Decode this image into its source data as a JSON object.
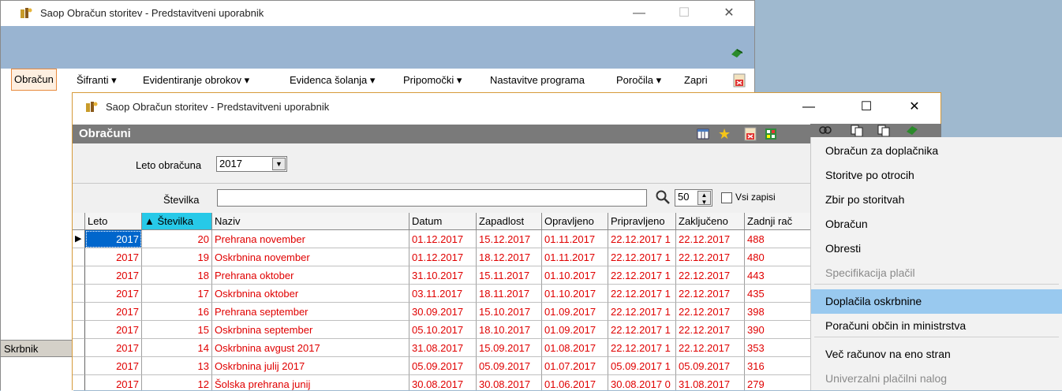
{
  "outer_window": {
    "title": "Saop Obračun storitev - Predstavitveni uporabnik",
    "controls": {
      "minimize": "—",
      "maximize": "☐",
      "close": "✕"
    }
  },
  "menubar": {
    "items": [
      {
        "label": "Obračun"
      },
      {
        "label": "Šifranti ▾"
      },
      {
        "label": "Evidentiranje obrokov ▾"
      },
      {
        "label": "Evidenca šolanja ▾"
      },
      {
        "label": "Pripomočki ▾"
      },
      {
        "label": "Nastavitve programa"
      },
      {
        "label": "Poročila ▾"
      },
      {
        "label": "Zapri"
      }
    ]
  },
  "left_panel": {
    "skrbnik": "Skrbnik"
  },
  "inner_window": {
    "title": "Saop Obračun storitev - Predstavitveni uporabnik",
    "controls": {
      "minimize": "—",
      "maximize": "☐",
      "close": "✕"
    },
    "header": "Obračuni"
  },
  "filters": {
    "leto_label": "Leto obračuna",
    "leto_value": "2017",
    "stevilka_label": "Številka",
    "stevilka_value": "",
    "page_size": "50",
    "vsi_zapisi_label": "Vsi zapisi"
  },
  "grid": {
    "columns": [
      "Leto",
      "▲ Številka",
      "Naziv",
      "Datum",
      "Zapadlost",
      "Opravljeno",
      "Pripravljeno",
      "Zaključeno",
      "Zadnji rač"
    ],
    "rows": [
      [
        "2017",
        "20",
        "Prehrana november",
        "01.12.2017",
        "15.12.2017",
        "01.11.2017",
        "22.12.2017 1",
        "22.12.2017",
        "488"
      ],
      [
        "2017",
        "19",
        "Oskrbnina november",
        "01.12.2017",
        "18.12.2017",
        "01.11.2017",
        "22.12.2017 1",
        "22.12.2017",
        "480"
      ],
      [
        "2017",
        "18",
        "Prehrana oktober",
        "31.10.2017",
        "15.11.2017",
        "01.10.2017",
        "22.12.2017 1",
        "22.12.2017",
        "443"
      ],
      [
        "2017",
        "17",
        "Oskrbnina oktober",
        "03.11.2017",
        "18.11.2017",
        "01.10.2017",
        "22.12.2017 1",
        "22.12.2017",
        "435"
      ],
      [
        "2017",
        "16",
        "Prehrana september",
        "30.09.2017",
        "15.10.2017",
        "01.09.2017",
        "22.12.2017 1",
        "22.12.2017",
        "398"
      ],
      [
        "2017",
        "15",
        "Oskrbnina september",
        "05.10.2017",
        "18.10.2017",
        "01.09.2017",
        "22.12.2017 1",
        "22.12.2017",
        "390"
      ],
      [
        "2017",
        "14",
        "Oskrbnina avgust 2017",
        "31.08.2017",
        "15.09.2017",
        "01.08.2017",
        "22.12.2017 1",
        "22.12.2017",
        "353"
      ],
      [
        "2017",
        "13",
        "Oskrbnina julij 2017",
        "05.09.2017",
        "05.09.2017",
        "01.07.2017",
        "05.09.2017 1",
        "05.09.2017",
        "316"
      ],
      [
        "2017",
        "12",
        "Šolska prehrana junij",
        "30.08.2017",
        "30.08.2017",
        "01.06.2017",
        "30.08.2017 0",
        "31.08.2017",
        "279"
      ]
    ]
  },
  "popup_menu": {
    "items": [
      {
        "label": "Obračun za doplačnika",
        "disabled": false
      },
      {
        "label": "Storitve po otrocih",
        "disabled": false
      },
      {
        "label": "Zbir po storitvah",
        "disabled": false
      },
      {
        "label": "Obračun",
        "disabled": false
      },
      {
        "label": "Obresti",
        "disabled": false
      },
      {
        "label": "Specifikacija plačil",
        "disabled": true
      },
      {
        "label": "Doplačila oskrbnine",
        "disabled": false,
        "highlighted": true
      },
      {
        "label": "Poračuni občin in ministrstva",
        "disabled": false
      },
      {
        "label": "Več računov na eno stran",
        "disabled": false
      },
      {
        "label": "Univerzalni plačilni nalog",
        "disabled": true
      }
    ]
  },
  "colors": {
    "row_text": "#e00000",
    "selection": "#0066cc",
    "sorted_header": "#27c9e8",
    "menu_highlight": "#99c9ef"
  }
}
